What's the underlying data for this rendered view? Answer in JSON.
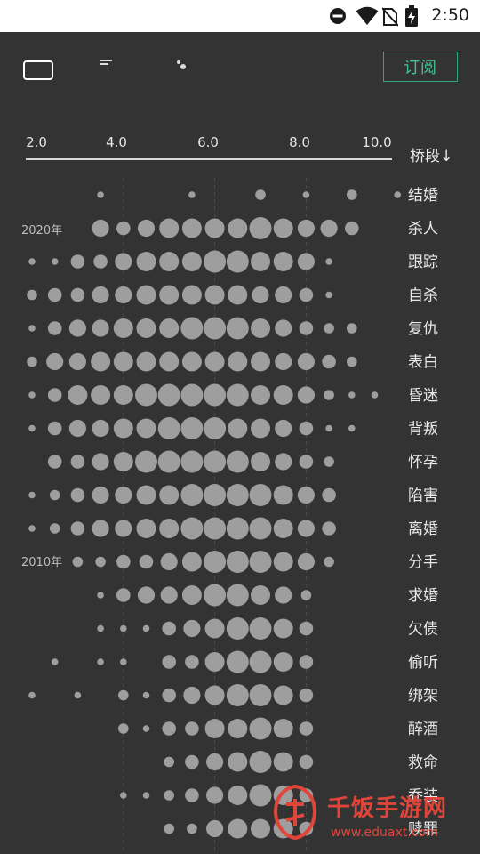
{
  "status_bar": {
    "time": "2:50",
    "icons": [
      "do-not-disturb-icon",
      "wifi-icon",
      "no-sim-icon",
      "battery-charging-icon"
    ]
  },
  "toolbar": {
    "subscribe_label": "订阅",
    "view_icons": [
      "card-view-icon",
      "list-view-icon",
      "dot-view-icon"
    ]
  },
  "axis": {
    "ticks": [
      "2.0",
      "4.0",
      "6.0",
      "8.0",
      "10.0"
    ],
    "sort_label": "桥段↓"
  },
  "colors": {
    "background": "#333333",
    "dot": "#9e9e9e",
    "accent": "#2ea77a",
    "watermark": "#e0453a"
  },
  "year_labels": [
    "2020年",
    "2010年"
  ],
  "chart_data": {
    "type": "scatter",
    "xlabel": "",
    "ylabel": "",
    "x_ticks": [
      2.0,
      4.0,
      6.0,
      8.0,
      10.0
    ],
    "xlim": [
      2.0,
      10.0
    ],
    "columns": [
      2.0,
      2.5,
      3.0,
      3.5,
      4.0,
      4.5,
      5.0,
      5.5,
      6.0,
      6.5,
      7.0,
      7.5,
      8.0,
      8.5,
      9.0,
      9.5,
      10.0
    ],
    "rows": [
      {
        "label": "结婚",
        "sizes": [
          0,
          0,
          0,
          1,
          0,
          0,
          0,
          1,
          0,
          0,
          2,
          0,
          1,
          0,
          2,
          0,
          1
        ]
      },
      {
        "label": "杀人",
        "sizes": [
          0,
          0,
          0,
          4,
          3,
          4,
          5,
          5,
          5,
          5,
          6,
          5,
          4,
          4,
          3,
          0,
          0
        ]
      },
      {
        "label": "跟踪",
        "sizes": [
          1,
          1,
          3,
          3,
          4,
          5,
          5,
          5,
          6,
          6,
          5,
          5,
          4,
          1,
          0,
          0,
          0
        ]
      },
      {
        "label": "自杀",
        "sizes": [
          2,
          3,
          3,
          4,
          4,
          5,
          5,
          5,
          5,
          5,
          4,
          4,
          3,
          1,
          0,
          0,
          0
        ]
      },
      {
        "label": "复仇",
        "sizes": [
          1,
          3,
          4,
          4,
          5,
          5,
          5,
          6,
          6,
          6,
          5,
          4,
          3,
          2,
          2,
          0,
          0
        ]
      },
      {
        "label": "表白",
        "sizes": [
          2,
          4,
          4,
          5,
          5,
          5,
          5,
          5,
          5,
          5,
          5,
          4,
          4,
          3,
          2,
          0,
          0
        ]
      },
      {
        "label": "昏迷",
        "sizes": [
          1,
          3,
          5,
          5,
          5,
          6,
          6,
          6,
          6,
          6,
          5,
          5,
          4,
          2,
          1,
          1,
          0
        ]
      },
      {
        "label": "背叛",
        "sizes": [
          1,
          3,
          4,
          4,
          5,
          5,
          6,
          6,
          6,
          5,
          5,
          4,
          3,
          1,
          1,
          0,
          0
        ]
      },
      {
        "label": "怀孕",
        "sizes": [
          0,
          3,
          3,
          4,
          5,
          6,
          6,
          6,
          6,
          6,
          5,
          4,
          3,
          2,
          0,
          0,
          0
        ]
      },
      {
        "label": "陷害",
        "sizes": [
          1,
          2,
          3,
          4,
          4,
          5,
          5,
          6,
          6,
          6,
          6,
          5,
          4,
          3,
          0,
          0,
          0
        ]
      },
      {
        "label": "离婚",
        "sizes": [
          1,
          2,
          3,
          4,
          4,
          5,
          5,
          6,
          6,
          6,
          6,
          5,
          4,
          3,
          0,
          0,
          0
        ]
      },
      {
        "label": "分手",
        "sizes": [
          0,
          0,
          2,
          2,
          3,
          3,
          4,
          5,
          6,
          6,
          6,
          5,
          4,
          2,
          0,
          0,
          0
        ]
      },
      {
        "label": "求婚",
        "sizes": [
          0,
          0,
          0,
          1,
          3,
          4,
          4,
          5,
          6,
          6,
          5,
          4,
          2,
          0,
          0,
          0,
          0
        ]
      },
      {
        "label": "欠债",
        "sizes": [
          0,
          0,
          0,
          1,
          1,
          1,
          3,
          4,
          5,
          6,
          6,
          5,
          3,
          0,
          0,
          0,
          0
        ]
      },
      {
        "label": "偷听",
        "sizes": [
          0,
          1,
          0,
          1,
          1,
          0,
          3,
          3,
          5,
          6,
          6,
          5,
          3,
          0,
          0,
          0,
          0
        ]
      },
      {
        "label": "绑架",
        "sizes": [
          1,
          0,
          1,
          0,
          2,
          1,
          3,
          4,
          5,
          6,
          6,
          5,
          3,
          0,
          0,
          0,
          0
        ]
      },
      {
        "label": "醉酒",
        "sizes": [
          0,
          0,
          0,
          0,
          2,
          1,
          3,
          3,
          5,
          5,
          6,
          5,
          3,
          0,
          0,
          0,
          0
        ]
      },
      {
        "label": "救命",
        "sizes": [
          0,
          0,
          0,
          0,
          0,
          0,
          2,
          3,
          4,
          5,
          6,
          5,
          3,
          0,
          0,
          0,
          0
        ]
      },
      {
        "label": "乔装",
        "sizes": [
          0,
          0,
          0,
          0,
          1,
          1,
          2,
          3,
          4,
          5,
          6,
          5,
          3,
          0,
          0,
          0,
          0
        ]
      },
      {
        "label": "赎罪",
        "sizes": [
          0,
          0,
          0,
          0,
          0,
          0,
          2,
          2,
          4,
          5,
          5,
          5,
          3,
          0,
          0,
          0,
          0
        ]
      }
    ]
  },
  "watermark": {
    "title": "千饭手游网",
    "url": "www.eduaxt.com"
  }
}
